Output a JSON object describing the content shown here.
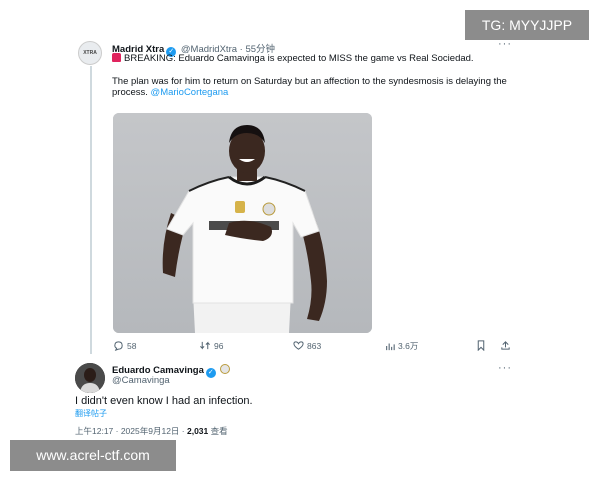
{
  "overlays": {
    "tg_label": "TG: MYYJJPP",
    "site_label": "www.acrel-ctf.com"
  },
  "tweet1": {
    "avatar_label": "XTRA",
    "name": "Madrid Xtra",
    "handle": "@MadridXtra",
    "time": "· 55分钟",
    "line1": "BREAKING: Eduardo Camavinga is expected to MISS the game vs Real Sociedad.",
    "line2": "The plan was for him to return on Saturday but an affection to the syndesmosis is delaying the process.",
    "mention": "@MarioCortegana",
    "actions": {
      "replies": "58",
      "retweets": "96",
      "likes": "863",
      "views": "3.6万"
    }
  },
  "tweet2": {
    "name": "Eduardo Camavinga",
    "handle": "@Camavinga",
    "text": "I didn't even know I had an infection.",
    "translate": "翻译帖子",
    "timestamp": "上午12:17 · 2025年9月12日 ·",
    "view_count": "2,031",
    "view_label": "查看"
  },
  "colors": {
    "accent": "#1d9bf0",
    "muted": "#536471",
    "overlay": "#8c8c8c"
  },
  "icons": [
    "reply-icon",
    "retweet-icon",
    "like-icon",
    "views-icon",
    "bookmark-icon",
    "share-icon",
    "verified-icon",
    "more-icon"
  ]
}
